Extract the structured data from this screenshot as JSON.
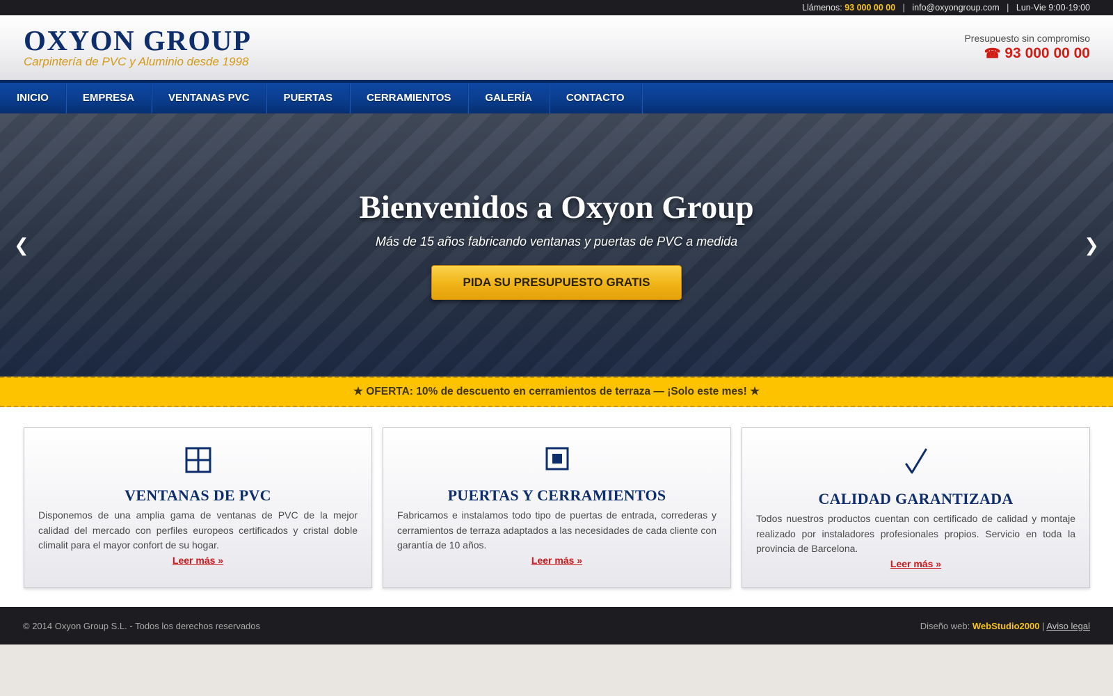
{
  "topbar": {
    "call_label": "Llámenos:",
    "phone": "93 000 00 00",
    "email": "info@oxyongroup.com",
    "hours": "Lun-Vie 9:00-19:00"
  },
  "header": {
    "logo_title": "OXYON GROUP",
    "logo_subtitle": "Carpintería de PVC y Aluminio desde 1998",
    "quote_label": "Presupuesto sin compromiso",
    "quote_phone": "93 000 00 00",
    "quote_phone_icon": "telephone-icon"
  },
  "nav": {
    "items": [
      {
        "label": "INICIO"
      },
      {
        "label": "EMPRESA"
      },
      {
        "label": "VENTANAS PVC"
      },
      {
        "label": "PUERTAS"
      },
      {
        "label": "CERRAMIENTOS"
      },
      {
        "label": "GALERÍA"
      },
      {
        "label": "CONTACTO"
      }
    ]
  },
  "hero": {
    "title": "Bienvenidos a Oxyon Group",
    "subtitle": "Más de 15 años fabricando ventanas y puertas de PVC a medida",
    "button_label": "PIDA SU PRESUPUESTO GRATIS",
    "prev_arrow": "❮",
    "next_arrow": "❯"
  },
  "offer": {
    "text": "★ OFERTA: 10% de descuento en cerramientos de terraza — ¡Solo este mes! ★"
  },
  "cards": [
    {
      "icon": "window-icon",
      "title": "VENTANAS DE PVC",
      "text": "Disponemos de una amplia gama de ventanas de PVC de la mejor calidad del mercado con perfiles europeos certificados y cristal doble climalit para el mayor confort de su hogar.",
      "link": "Leer más »"
    },
    {
      "icon": "door-icon",
      "title": "PUERTAS Y CERRAMIENTOS",
      "text": "Fabricamos e instalamos todo tipo de puertas de entrada, correderas y cerramientos de terraza adaptados a las necesidades de cada cliente con garantía de 10 años.",
      "link": "Leer más »"
    },
    {
      "icon": "check-icon",
      "title": "CALIDAD GARANTIZADA",
      "text": "Todos nuestros productos cuentan con certificado de calidad y montaje realizado por instaladores profesionales propios. Servicio en toda la provincia de Barcelona.",
      "link": "Leer más »"
    }
  ],
  "footer": {
    "copyright": "© 2014 Oxyon Group S.L. - Todos los derechos reservados",
    "design_label": "Diseño web:",
    "design_brand": "WebStudio2000",
    "separator": "|",
    "legal_link": "Aviso legal"
  },
  "colors": {
    "navy": "#0d2e6b",
    "nav_blue": "#0a3d8e",
    "gold": "#f0b416",
    "offer_yellow": "#fdc300",
    "red": "#cf1d14",
    "dark": "#1d1c20"
  }
}
